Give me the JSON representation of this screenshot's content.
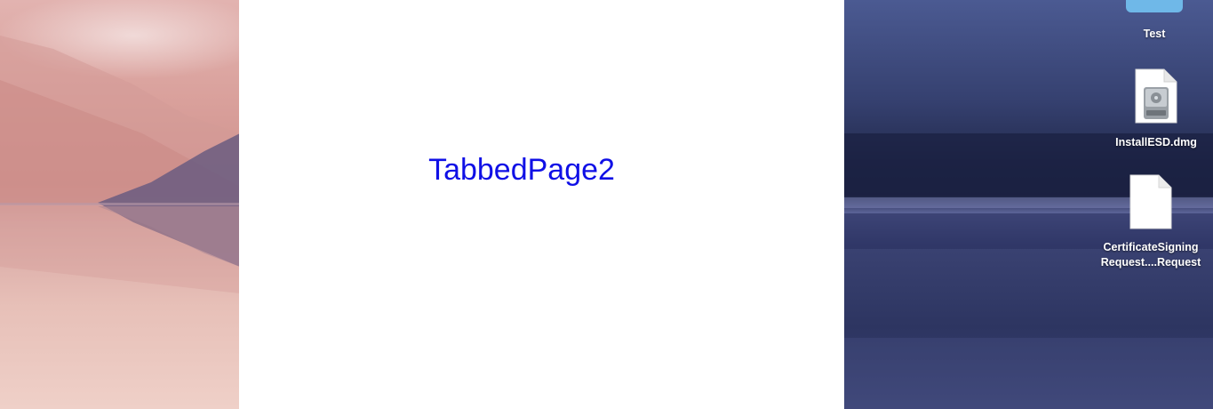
{
  "app": {
    "page_label": "TabbedPage2",
    "label_color": "#1010e6"
  },
  "desktop": {
    "icons": [
      {
        "label": "Test",
        "icon": "folder-icon"
      },
      {
        "label": "InstallESD.dmg",
        "icon": "disk-image-icon"
      },
      {
        "label_line1": "CertificateSigning",
        "label_line2": "Request....Request",
        "icon": "document-icon"
      }
    ]
  }
}
